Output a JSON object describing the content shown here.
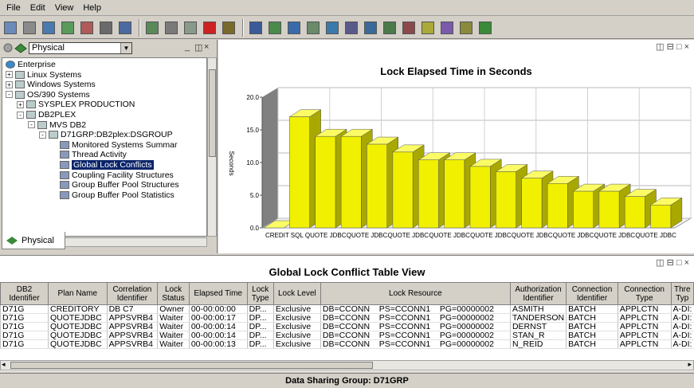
{
  "menu": [
    "File",
    "Edit",
    "View",
    "Help"
  ],
  "toolbar_icons": [
    "save-icon",
    "properties-icon",
    "monitor-icon",
    "network-icon",
    "connect-icon",
    "tools-icon",
    "window-icon",
    "refresh-icon",
    "grid-icon",
    "reload-icon",
    "stop-icon",
    "sound-icon",
    "table-icon",
    "globe-icon",
    "bar-chart-icon",
    "line-chart-icon",
    "area-chart-icon",
    "layout-icon",
    "columns-icon",
    "report-icon",
    "image-icon",
    "dashboard-icon",
    "arrows-icon",
    "book-icon",
    "ball-icon"
  ],
  "left_panel": {
    "view_select": "Physical",
    "tab_label": "Physical",
    "tree": [
      {
        "label": "Enterprise",
        "depth": 0,
        "expander": ""
      },
      {
        "label": "Linux Systems",
        "depth": 0,
        "expander": "+"
      },
      {
        "label": "Windows Systems",
        "depth": 0,
        "expander": "+"
      },
      {
        "label": "OS/390 Systems",
        "depth": 0,
        "expander": "-"
      },
      {
        "label": "SYSPLEX PRODUCTION",
        "depth": 1,
        "expander": "+"
      },
      {
        "label": "DB2PLEX",
        "depth": 1,
        "expander": "-"
      },
      {
        "label": "MVS DB2",
        "depth": 2,
        "expander": "-"
      },
      {
        "label": "D71GRP:DB2plex:DSGROUP",
        "depth": 3,
        "expander": "-"
      },
      {
        "label": "Monitored Systems Summar",
        "depth": 4,
        "expander": ""
      },
      {
        "label": "Thread Activity",
        "depth": 4,
        "expander": ""
      },
      {
        "label": "Global Lock Conflicts",
        "depth": 4,
        "expander": "",
        "selected": true
      },
      {
        "label": "Coupling Facility Structures",
        "depth": 4,
        "expander": ""
      },
      {
        "label": "Group Buffer Pool Structures",
        "depth": 4,
        "expander": ""
      },
      {
        "label": "Group Buffer Pool Statistics",
        "depth": 4,
        "expander": ""
      }
    ]
  },
  "chart_data": {
    "type": "bar",
    "title": "Lock Elapsed Time in Seconds",
    "ylabel": "Seconds",
    "ylim": [
      0,
      20
    ],
    "yticks": [
      "0.0",
      "5.0",
      "10.0",
      "15.0",
      "20.0"
    ],
    "categories": [
      "CREDITORY",
      "QUOTEJDBC",
      "QUOTEJDBC",
      "QUOTEJDBC",
      "QUOTEJDBC",
      "QUOTEJDBC",
      "QUOTEJDBC",
      "QUOTEJDBC",
      "QUOTEJDBC",
      "QUOTEJDBC",
      "QUOTEJDBC",
      "QUOTEJDBC",
      "QUOTEJDBC",
      "QUOTEJDBC",
      "QUOTEJDBC",
      "QUOTEJDBC"
    ],
    "xtick_labels": [
      "CREDIT SQL",
      "QUOTE JDBC",
      "QUOTE JDBC",
      "QUOTE JDBC",
      "QUOTE JDBC",
      "QUOTE JDBC",
      "QUOTE JDBC",
      "QUOTE JDBC",
      "QUOTE JDBC",
      "QUOTE JDBC"
    ],
    "values": [
      0.0,
      17.0,
      14.0,
      14.0,
      12.8,
      11.6,
      10.4,
      10.4,
      9.4,
      8.6,
      7.6,
      6.8,
      5.6,
      5.6,
      4.8,
      3.5
    ],
    "bar_color": "#f0f000",
    "grid": true
  },
  "table": {
    "title": "Global Lock Conflict Table View",
    "columns": [
      "DB2 Identifier",
      "Plan Name",
      "Correlation Identifier",
      "Lock Status",
      "Elapsed Time",
      "Lock Type",
      "Lock Level",
      "Lock Resource",
      "Authorization Identifier",
      "Connection Identifier",
      "Connection Type",
      "Thre Typ"
    ],
    "rows": [
      [
        "D71G",
        "CREDITORY",
        "DB C7",
        "Owner",
        "00-00:00:00",
        "DP...",
        "Exclusive",
        "DB=CCONN    PS=CCONN1    PG=00000002",
        "ASMITH",
        "BATCH",
        "APPLCTN",
        "A-DI:"
      ],
      [
        "D71G",
        "QUOTEJDBC",
        "APPSVRB4",
        "Waiter",
        "00-00:00:17",
        "DP...",
        "Exclusive",
        "DB=CCONN    PS=CCONN1    PG=00000002",
        "TANDERSON",
        "BATCH",
        "APPLCTN",
        "A-DI:"
      ],
      [
        "D71G",
        "QUOTEJDBC",
        "APPSVRB4",
        "Waiter",
        "00-00:00:14",
        "DP...",
        "Exclusive",
        "DB=CCONN    PS=CCONN1    PG=00000002",
        "DERNST",
        "BATCH",
        "APPLCTN",
        "A-DI:"
      ],
      [
        "D71G",
        "QUOTEJDBC",
        "APPSVRB4",
        "Waiter",
        "00-00:00:14",
        "DP...",
        "Exclusive",
        "DB=CCONN    PS=CCONN1    PG=00000002",
        "STAN_R",
        "BATCH",
        "APPLCTN",
        "A-DI:"
      ],
      [
        "D71G",
        "QUOTEJDBC",
        "APPSVRB4",
        "Waiter",
        "00-00:00:13",
        "DP...",
        "Exclusive",
        "DB=CCONN    PS=CCONN1    PG=00000002",
        "N_REID",
        "BATCH",
        "APPLCTN",
        "A-DI:"
      ]
    ]
  },
  "status_bar": "Data Sharing Group: D71GRP"
}
